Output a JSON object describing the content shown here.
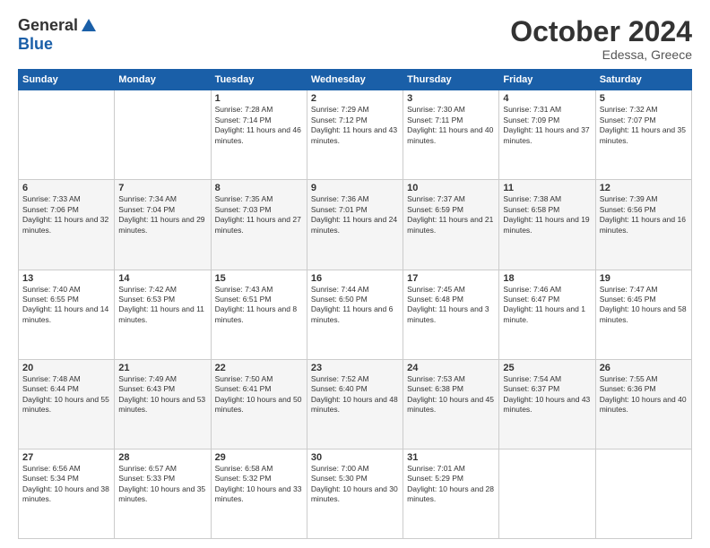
{
  "header": {
    "logo": {
      "general": "General",
      "blue": "Blue"
    },
    "title": "October 2024",
    "location": "Edessa, Greece"
  },
  "weekdays": [
    "Sunday",
    "Monday",
    "Tuesday",
    "Wednesday",
    "Thursday",
    "Friday",
    "Saturday"
  ],
  "weeks": [
    [
      {
        "day": "",
        "sunrise": "",
        "sunset": "",
        "daylight": ""
      },
      {
        "day": "",
        "sunrise": "",
        "sunset": "",
        "daylight": ""
      },
      {
        "day": "1",
        "sunrise": "Sunrise: 7:28 AM",
        "sunset": "Sunset: 7:14 PM",
        "daylight": "Daylight: 11 hours and 46 minutes."
      },
      {
        "day": "2",
        "sunrise": "Sunrise: 7:29 AM",
        "sunset": "Sunset: 7:12 PM",
        "daylight": "Daylight: 11 hours and 43 minutes."
      },
      {
        "day": "3",
        "sunrise": "Sunrise: 7:30 AM",
        "sunset": "Sunset: 7:11 PM",
        "daylight": "Daylight: 11 hours and 40 minutes."
      },
      {
        "day": "4",
        "sunrise": "Sunrise: 7:31 AM",
        "sunset": "Sunset: 7:09 PM",
        "daylight": "Daylight: 11 hours and 37 minutes."
      },
      {
        "day": "5",
        "sunrise": "Sunrise: 7:32 AM",
        "sunset": "Sunset: 7:07 PM",
        "daylight": "Daylight: 11 hours and 35 minutes."
      }
    ],
    [
      {
        "day": "6",
        "sunrise": "Sunrise: 7:33 AM",
        "sunset": "Sunset: 7:06 PM",
        "daylight": "Daylight: 11 hours and 32 minutes."
      },
      {
        "day": "7",
        "sunrise": "Sunrise: 7:34 AM",
        "sunset": "Sunset: 7:04 PM",
        "daylight": "Daylight: 11 hours and 29 minutes."
      },
      {
        "day": "8",
        "sunrise": "Sunrise: 7:35 AM",
        "sunset": "Sunset: 7:03 PM",
        "daylight": "Daylight: 11 hours and 27 minutes."
      },
      {
        "day": "9",
        "sunrise": "Sunrise: 7:36 AM",
        "sunset": "Sunset: 7:01 PM",
        "daylight": "Daylight: 11 hours and 24 minutes."
      },
      {
        "day": "10",
        "sunrise": "Sunrise: 7:37 AM",
        "sunset": "Sunset: 6:59 PM",
        "daylight": "Daylight: 11 hours and 21 minutes."
      },
      {
        "day": "11",
        "sunrise": "Sunrise: 7:38 AM",
        "sunset": "Sunset: 6:58 PM",
        "daylight": "Daylight: 11 hours and 19 minutes."
      },
      {
        "day": "12",
        "sunrise": "Sunrise: 7:39 AM",
        "sunset": "Sunset: 6:56 PM",
        "daylight": "Daylight: 11 hours and 16 minutes."
      }
    ],
    [
      {
        "day": "13",
        "sunrise": "Sunrise: 7:40 AM",
        "sunset": "Sunset: 6:55 PM",
        "daylight": "Daylight: 11 hours and 14 minutes."
      },
      {
        "day": "14",
        "sunrise": "Sunrise: 7:42 AM",
        "sunset": "Sunset: 6:53 PM",
        "daylight": "Daylight: 11 hours and 11 minutes."
      },
      {
        "day": "15",
        "sunrise": "Sunrise: 7:43 AM",
        "sunset": "Sunset: 6:51 PM",
        "daylight": "Daylight: 11 hours and 8 minutes."
      },
      {
        "day": "16",
        "sunrise": "Sunrise: 7:44 AM",
        "sunset": "Sunset: 6:50 PM",
        "daylight": "Daylight: 11 hours and 6 minutes."
      },
      {
        "day": "17",
        "sunrise": "Sunrise: 7:45 AM",
        "sunset": "Sunset: 6:48 PM",
        "daylight": "Daylight: 11 hours and 3 minutes."
      },
      {
        "day": "18",
        "sunrise": "Sunrise: 7:46 AM",
        "sunset": "Sunset: 6:47 PM",
        "daylight": "Daylight: 11 hours and 1 minute."
      },
      {
        "day": "19",
        "sunrise": "Sunrise: 7:47 AM",
        "sunset": "Sunset: 6:45 PM",
        "daylight": "Daylight: 10 hours and 58 minutes."
      }
    ],
    [
      {
        "day": "20",
        "sunrise": "Sunrise: 7:48 AM",
        "sunset": "Sunset: 6:44 PM",
        "daylight": "Daylight: 10 hours and 55 minutes."
      },
      {
        "day": "21",
        "sunrise": "Sunrise: 7:49 AM",
        "sunset": "Sunset: 6:43 PM",
        "daylight": "Daylight: 10 hours and 53 minutes."
      },
      {
        "day": "22",
        "sunrise": "Sunrise: 7:50 AM",
        "sunset": "Sunset: 6:41 PM",
        "daylight": "Daylight: 10 hours and 50 minutes."
      },
      {
        "day": "23",
        "sunrise": "Sunrise: 7:52 AM",
        "sunset": "Sunset: 6:40 PM",
        "daylight": "Daylight: 10 hours and 48 minutes."
      },
      {
        "day": "24",
        "sunrise": "Sunrise: 7:53 AM",
        "sunset": "Sunset: 6:38 PM",
        "daylight": "Daylight: 10 hours and 45 minutes."
      },
      {
        "day": "25",
        "sunrise": "Sunrise: 7:54 AM",
        "sunset": "Sunset: 6:37 PM",
        "daylight": "Daylight: 10 hours and 43 minutes."
      },
      {
        "day": "26",
        "sunrise": "Sunrise: 7:55 AM",
        "sunset": "Sunset: 6:36 PM",
        "daylight": "Daylight: 10 hours and 40 minutes."
      }
    ],
    [
      {
        "day": "27",
        "sunrise": "Sunrise: 6:56 AM",
        "sunset": "Sunset: 5:34 PM",
        "daylight": "Daylight: 10 hours and 38 minutes."
      },
      {
        "day": "28",
        "sunrise": "Sunrise: 6:57 AM",
        "sunset": "Sunset: 5:33 PM",
        "daylight": "Daylight: 10 hours and 35 minutes."
      },
      {
        "day": "29",
        "sunrise": "Sunrise: 6:58 AM",
        "sunset": "Sunset: 5:32 PM",
        "daylight": "Daylight: 10 hours and 33 minutes."
      },
      {
        "day": "30",
        "sunrise": "Sunrise: 7:00 AM",
        "sunset": "Sunset: 5:30 PM",
        "daylight": "Daylight: 10 hours and 30 minutes."
      },
      {
        "day": "31",
        "sunrise": "Sunrise: 7:01 AM",
        "sunset": "Sunset: 5:29 PM",
        "daylight": "Daylight: 10 hours and 28 minutes."
      },
      {
        "day": "",
        "sunrise": "",
        "sunset": "",
        "daylight": ""
      },
      {
        "day": "",
        "sunrise": "",
        "sunset": "",
        "daylight": ""
      }
    ]
  ]
}
